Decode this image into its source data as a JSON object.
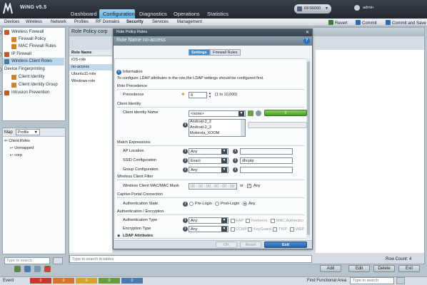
{
  "app": {
    "brand": "WiNG v5.5"
  },
  "main_tabs": [
    "Dashboard",
    "Configuration",
    "Diagnostics",
    "Operations",
    "Statistics"
  ],
  "device": {
    "label": "RFS6000"
  },
  "user": {
    "name": "admin"
  },
  "sub_tabs": [
    "Devices",
    "Wireless",
    "Network",
    "Profiles",
    "RF Domains",
    "Security",
    "Services",
    "Management"
  ],
  "sub_actions": {
    "revert": "Revert",
    "commit": "Commit",
    "commit_save": "Commit and Save"
  },
  "left_nav": [
    "Wireless Firewall",
    "Firewall Policy",
    "MAC Firewall Rules",
    "IP Firewall",
    "Wireless Client Roles",
    "Device Fingerprinting",
    "Client Identity",
    "Client Identity Group",
    "Intrusion Prevention"
  ],
  "map": {
    "label": "Map",
    "profile": "Profile",
    "tree": [
      "Client Roles",
      "Unmapped",
      "corp"
    ],
    "search_placeholder": "Type to search"
  },
  "center": {
    "title": "Role Policy  corp",
    "list_header": "Role Name",
    "rows": [
      "iOS-role",
      "no-access",
      "Ubuntu11-role",
      "Windows-role"
    ],
    "search_placeholder": "Type to search in tables",
    "row_count_label": "Row Count:",
    "row_count": "4",
    "actions": {
      "add": "Add",
      "edit": "Edit",
      "delete": "Delete",
      "exit": "Exit"
    }
  },
  "dialog": {
    "title": "Role Policy Roles",
    "heading": "Role Name  no-access",
    "tabs": [
      "Settings",
      "Firewall Rules"
    ],
    "info_title": "Information",
    "info_text": "To configure LDAP attributes in the role,the LDAP settings should be configured first.",
    "role_precedence": {
      "section": "Role Precedence",
      "label": "Precedence",
      "value": "4",
      "range": "(1 to 10,000)"
    },
    "client_identity": {
      "section": "Client Identity",
      "label": "Client Identity Name",
      "selected": "<none>",
      "options": [
        "Android-2_2",
        "Android-2_3",
        "Motorola_XOOM"
      ]
    },
    "match": {
      "section": "Match Expressions",
      "ap_location": {
        "label": "AP Location",
        "value": "Any"
      },
      "ssid": {
        "label": "SSID Configuration",
        "value": "Exact",
        "text": "dhcptp"
      },
      "group": {
        "label": "Group Configuration",
        "value": "Any"
      }
    },
    "wireless_filter": {
      "section": "Wireless Client Filter",
      "label": "Wireless Client MAC/MAC Mask",
      "mac": "00 - 00 - 00 - 00 - 00 - 00",
      "or": "or",
      "any": "Any"
    },
    "captive": {
      "section": "Captive Portal Connection",
      "label": "Authentication State",
      "options": [
        "Pre-Login",
        "Post-Login",
        "Any"
      ]
    },
    "auth_enc": {
      "section": "Authentication / Encryption",
      "auth_type": {
        "label": "Authentication Type",
        "value": "Any",
        "options": [
          "EAP",
          "Kerberos",
          "MAC Authenticati"
        ]
      },
      "enc_type": {
        "label": "Encryption Type",
        "value": "Any",
        "options": [
          "CCMP",
          "KeyGuard",
          "TKIP",
          "WEP1"
        ]
      }
    },
    "ldap": "LDAP Attributes",
    "buttons": {
      "ok": "OK",
      "reset": "Reset",
      "exit": "Exit"
    }
  },
  "status": {
    "event_label": "Event",
    "counts": [
      "0",
      "0",
      "0",
      "0",
      "0"
    ],
    "count_colors": [
      "#c43b2b",
      "#d9742b",
      "#d9a42b",
      "#6a9a3a",
      "#4b7ab0"
    ],
    "find_label": "Find Functional Area",
    "search_placeholder": "Type to search"
  }
}
